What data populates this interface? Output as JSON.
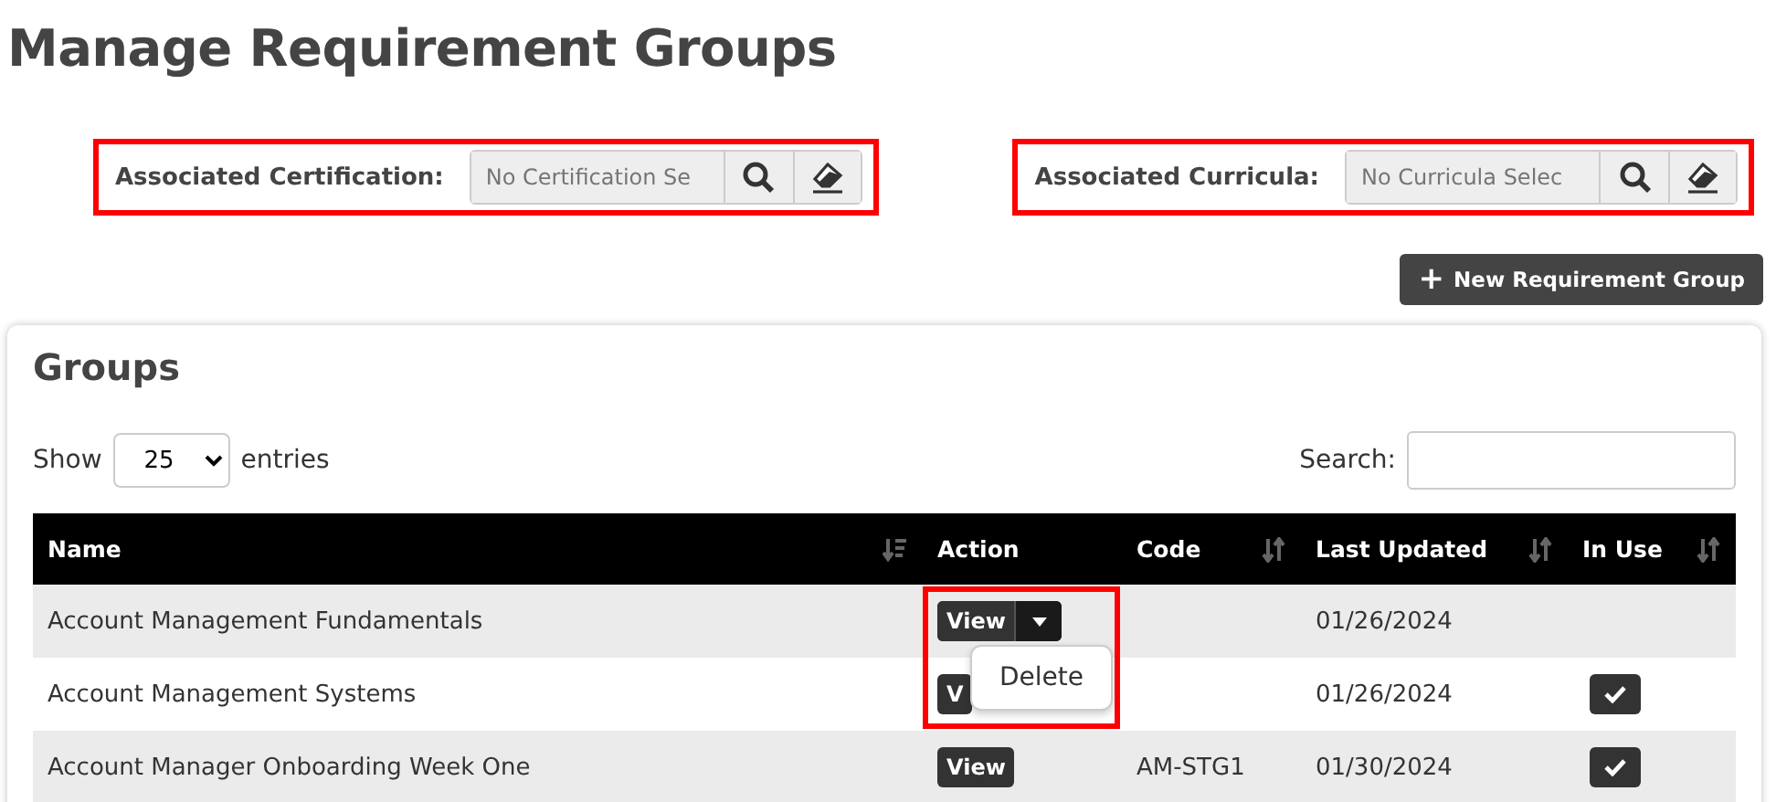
{
  "title": "Manage Requirement Groups",
  "filters": [
    {
      "label": "Associated Certification:",
      "placeholder": "No Certification Se",
      "highlighted": true
    },
    {
      "label": "Associated Curricula:",
      "placeholder": "No Curricula Selec",
      "highlighted": true
    }
  ],
  "new_button": {
    "icon": "+",
    "label": "New Requirement Group"
  },
  "panel": {
    "title": "Groups",
    "show_label": "Show",
    "page_size": "25",
    "entries_label": "entries",
    "search_label": "Search:"
  },
  "columns": [
    {
      "label": "Name",
      "kind": "sorted"
    },
    {
      "label": "Action",
      "kind": "plain"
    },
    {
      "label": "Code",
      "kind": "sortable"
    },
    {
      "label": "Last Updated",
      "kind": "sortable"
    },
    {
      "label": "In Use",
      "kind": "sortable"
    }
  ],
  "rows": [
    {
      "name": "Account Management Fundamentals",
      "action": {
        "label": "View",
        "menu_open": true,
        "highlighted": true,
        "menu": [
          "Delete"
        ]
      },
      "code": "",
      "last_updated": "01/26/2024",
      "in_use": false
    },
    {
      "name": "Account Management Systems",
      "action": {
        "label": "V"
      },
      "code": "",
      "last_updated": "01/26/2024",
      "in_use": true
    },
    {
      "name": "Account Manager Onboarding Week One",
      "action": {
        "label": "View"
      },
      "code": "AM-STG1",
      "last_updated": "01/30/2024",
      "in_use": true
    }
  ]
}
